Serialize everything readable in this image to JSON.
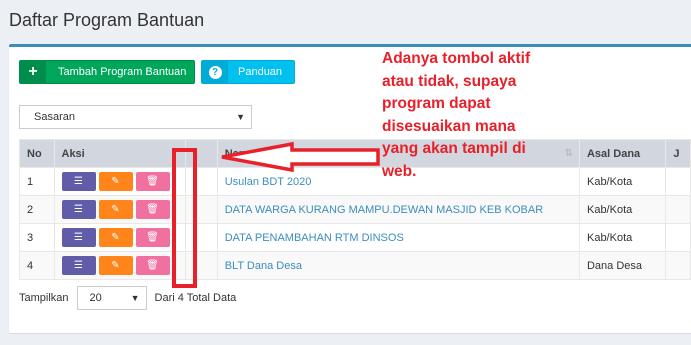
{
  "page_title": "Daftar Program Bantuan",
  "toolbar": {
    "add_label": "Tambah Program Bantuan",
    "add_icon": "+",
    "guide_label": "Panduan",
    "guide_icon": "?"
  },
  "filter": {
    "sasaran_value": "Sasaran"
  },
  "table": {
    "headers": {
      "no": "No",
      "aksi": "Aksi",
      "name": "Nama Program",
      "asal": "Asal Dana",
      "extra": "J"
    },
    "rows": [
      {
        "no": "1",
        "name": "Usulan BDT 2020",
        "asal": "Kab/Kota"
      },
      {
        "no": "2",
        "name": "DATA WARGA KURANG MAMPU.DEWAN MASJID KEB KOBAR",
        "asal": "Kab/Kota"
      },
      {
        "no": "3",
        "name": "DATA PENAMBAHAN RTM DINSOS",
        "asal": "Kab/Kota"
      },
      {
        "no": "4",
        "name": "BLT Dana Desa",
        "asal": "Dana Desa"
      }
    ]
  },
  "footer": {
    "show_label": "Tampilkan",
    "page_size": "20",
    "total_text": "Dari 4 Total Data"
  },
  "annotation": {
    "text": "Adanya tombol aktif\natau tidak, supaya\nprogram dapat\ndisesuaikan mana\nyang akan tampil di\nweb.",
    "color": "#e8202a"
  },
  "colors": {
    "add_button": "#00a65a",
    "guide_button": "#00c0ef",
    "list_button": "#605ca8",
    "edit_button": "#ff851b",
    "delete_button": "#f070a0",
    "link": "#3c8dbc"
  }
}
